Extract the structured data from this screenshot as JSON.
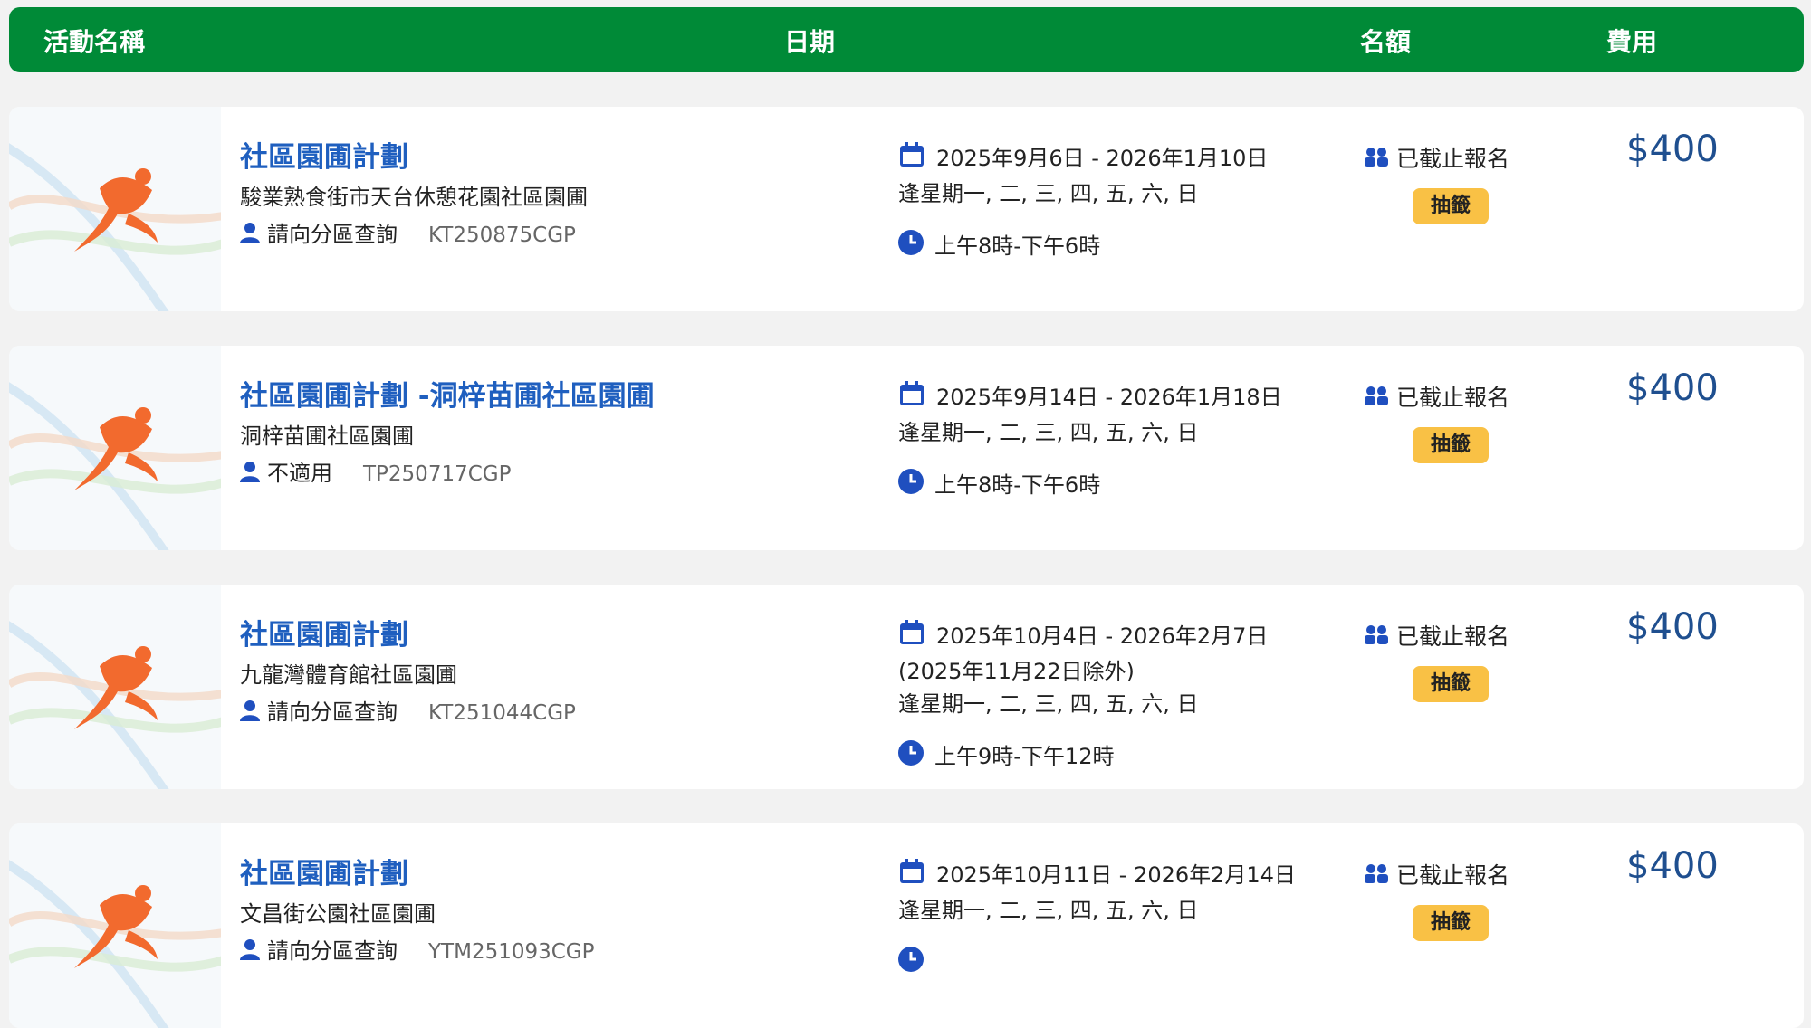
{
  "header": {
    "col_name": "活動名稱",
    "col_date": "日期",
    "col_quota": "名額",
    "col_fee": "費用"
  },
  "activities": [
    {
      "title": "社區園圃計劃",
      "venue": "駿業熟食街市天台休憩花園社區園圃",
      "district": "請向分區查詢",
      "code": "KT250875CGP",
      "date_range": "2025年9月6日 - 2026年1月10日",
      "date_note": "",
      "weekdays": "逢星期一, 二, 三, 四, 五, 六, 日",
      "time": "上午8時-下午6時",
      "quota_status": "已截止報名",
      "badge": "抽籤",
      "fee": "$400"
    },
    {
      "title": "社區園圃計劃 -洞梓苗圃社區園圃",
      "venue": "洞梓苗圃社區園圃",
      "district": "不適用",
      "code": "TP250717CGP",
      "date_range": "2025年9月14日 - 2026年1月18日",
      "date_note": "",
      "weekdays": "逢星期一, 二, 三, 四, 五, 六, 日",
      "time": "上午8時-下午6時",
      "quota_status": "已截止報名",
      "badge": "抽籤",
      "fee": "$400"
    },
    {
      "title": "社區園圃計劃",
      "venue": "九龍灣體育館社區園圃",
      "district": "請向分區查詢",
      "code": "KT251044CGP",
      "date_range": "2025年10月4日 - 2026年2月7日",
      "date_note": "(2025年11月22日除外)",
      "weekdays": "逢星期一, 二, 三, 四, 五, 六, 日",
      "time": "上午9時-下午12時",
      "quota_status": "已截止報名",
      "badge": "抽籤",
      "fee": "$400"
    },
    {
      "title": "社區園圃計劃",
      "venue": "文昌街公園社區園圃",
      "district": "請向分區查詢",
      "code": "YTM251093CGP",
      "date_range": "2025年10月11日 - 2026年2月14日",
      "date_note": "",
      "weekdays": "逢星期一, 二, 三, 四, 五, 六, 日",
      "time": "",
      "quota_status": "已截止報名",
      "badge": "抽籤",
      "fee": "$400"
    }
  ],
  "icons": {
    "thumbnail": "runner-logo-icon",
    "district": "person-icon",
    "date": "calendar-icon",
    "time": "clock-icon",
    "quota": "people-icon"
  },
  "colors": {
    "header_bg": "#008a37",
    "title": "#1f5fbf",
    "fee": "#1f4f8f",
    "badge": "#f9c145",
    "icon": "#1f4fbf",
    "runner": "#f26a2e"
  }
}
